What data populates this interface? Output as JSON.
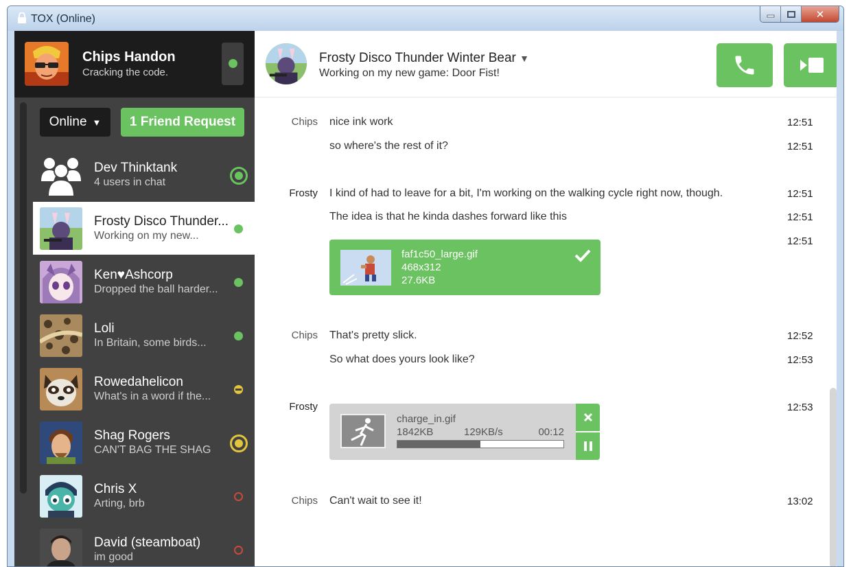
{
  "window": {
    "title": "TOX (Online)"
  },
  "self": {
    "name": "Chips Handon",
    "status": "Cracking the code."
  },
  "filter": {
    "label": "Online",
    "arrow": "▼"
  },
  "friend_request": {
    "label": "1 Friend Request"
  },
  "friends": [
    {
      "name": "Dev Thinktank",
      "status": "4 users in chat",
      "state": "online-group"
    },
    {
      "name": "Frosty Disco Thunder...",
      "status": "Working on my new...",
      "state": "online",
      "active": true
    },
    {
      "name": "Ken♥Ashcorp",
      "status": "Dropped the ball harder...",
      "state": "online"
    },
    {
      "name": "Loli",
      "status": "In Britain, some birds...",
      "state": "online"
    },
    {
      "name": "Rowedahelicon",
      "status": "What's in a word if the...",
      "state": "away"
    },
    {
      "name": "Shag Rogers",
      "status": "CAN'T BAG THE SHAG",
      "state": "away-notify"
    },
    {
      "name": "Chris X",
      "status": "Arting, brb",
      "state": "offline"
    },
    {
      "name": "David (steamboat)",
      "status": "im good",
      "state": "offline"
    }
  ],
  "chat": {
    "name": "Frosty Disco Thunder Winter Bear",
    "name_arrow": "▼",
    "status": "Working on my new game: Door Fist!",
    "messages": [
      {
        "author": "Chips",
        "text": "nice ink work",
        "time": "12:51"
      },
      {
        "author": "",
        "text": "so where's the rest of it?",
        "time": "12:51"
      },
      {
        "author": "Frosty",
        "text": "I kind of had to leave for a bit, I'm working on the walking cycle right now, though.",
        "time": "12:51"
      },
      {
        "author": "",
        "text": "The idea is that he kinda dashes forward like this",
        "time": "12:51"
      },
      {
        "author": "",
        "text": "",
        "time": "12:51"
      },
      {
        "author": "Chips",
        "text": "That's pretty slick.",
        "time": "12:52"
      },
      {
        "author": "",
        "text": "So what does yours look like?",
        "time": "12:53"
      },
      {
        "author": "Frosty",
        "text": "",
        "time": "12:53"
      },
      {
        "author": "Chips",
        "text": "Can't wait to see it!",
        "time": "13:02"
      }
    ],
    "file_done": {
      "name": "faf1c50_large.gif",
      "dims": "468x312",
      "size": "27.6KB"
    },
    "file_transfer": {
      "name": "charge_in.gif",
      "size": "1842KB",
      "speed": "129KB/s",
      "eta": "00:12",
      "progress": 0.5
    }
  },
  "colors": {
    "accent": "#6bc260",
    "away": "#e3c53d",
    "offline": "#c94a3b",
    "sidebar": "#414141",
    "header": "#1c1c1c"
  }
}
